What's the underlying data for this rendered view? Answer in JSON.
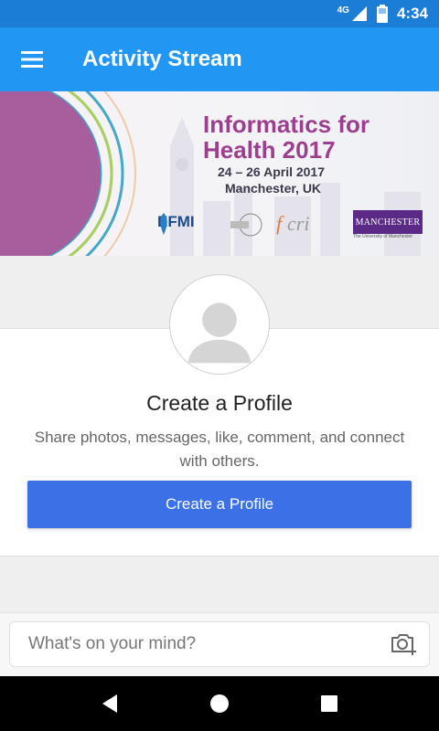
{
  "status_bar": {
    "network": "4G",
    "time": "4:34"
  },
  "app_bar": {
    "title": "Activity Stream",
    "menu_icon": "hamburger-menu-icon"
  },
  "banner": {
    "title_line1": "Informatics for",
    "title_line2": "Health 2017",
    "dates": "24 – 26 April 2017",
    "location": "Manchester, UK",
    "logos": {
      "efmi": "EFMI",
      "manchester": "MANCHESTER",
      "manchester_sub": "The University of Manchester"
    }
  },
  "profile_card": {
    "heading": "Create a Profile",
    "description": "Share photos, messages, like, comment, and connect with others.",
    "button_label": "Create a Profile"
  },
  "composer": {
    "placeholder": "What's on your mind?",
    "camera_icon": "camera-add-icon"
  },
  "nav_bar": {
    "icons": [
      "back-icon",
      "home-icon",
      "recents-icon"
    ]
  },
  "colors": {
    "status_bar": "#1c7dd6",
    "app_bar": "#2196f3",
    "primary_button": "#3b70e6",
    "banner_accent": "#9b3f8e"
  }
}
